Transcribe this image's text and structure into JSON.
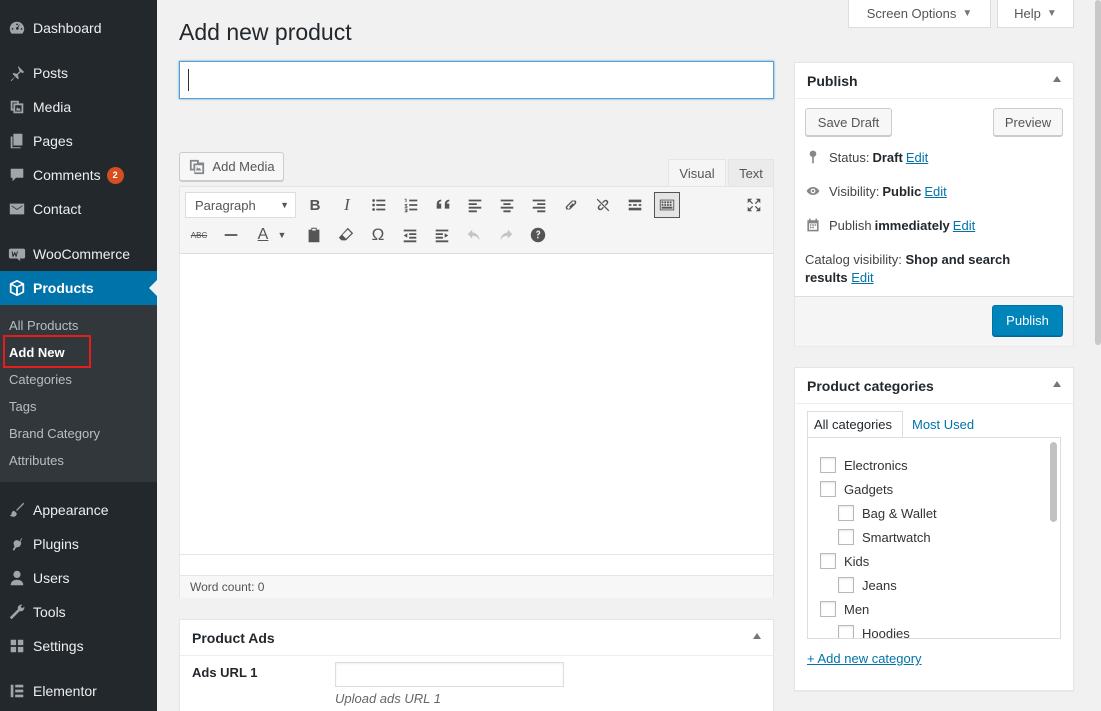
{
  "sidebar": {
    "items": [
      {
        "label": "Dashboard",
        "icon": "dashboard-icon"
      },
      {
        "label": "Posts",
        "icon": "pin-icon"
      },
      {
        "label": "Media",
        "icon": "media-icon"
      },
      {
        "label": "Pages",
        "icon": "pages-icon"
      },
      {
        "label": "Comments",
        "icon": "comment-icon",
        "badge": "2"
      },
      {
        "label": "Contact",
        "icon": "mail-icon"
      },
      {
        "label": "WooCommerce",
        "icon": "woo-icon"
      },
      {
        "label": "Products",
        "icon": "box-icon"
      },
      {
        "label": "Appearance",
        "icon": "brush-icon"
      },
      {
        "label": "Plugins",
        "icon": "plug-icon"
      },
      {
        "label": "Users",
        "icon": "user-icon"
      },
      {
        "label": "Tools",
        "icon": "wrench-icon"
      },
      {
        "label": "Settings",
        "icon": "settings-icon"
      },
      {
        "label": "Elementor",
        "icon": "elementor-icon"
      }
    ],
    "submenu": [
      "All Products",
      "Add New",
      "Categories",
      "Tags",
      "Brand Category",
      "Attributes"
    ]
  },
  "header": {
    "screen_options": "Screen Options",
    "help": "Help"
  },
  "main": {
    "title": "Add new product",
    "title_input_value": "",
    "add_media": "Add Media",
    "tab_visual": "Visual",
    "tab_text": "Text",
    "format_select": "Paragraph",
    "word_count": "Word count: 0"
  },
  "publish": {
    "heading": "Publish",
    "save_draft": "Save Draft",
    "preview": "Preview",
    "status_label": "Status:",
    "status_value": "Draft",
    "visibility_label": "Visibility:",
    "visibility_value": "Public",
    "publish_label": "Publish",
    "publish_value": "immediately",
    "catalog_label": "Catalog visibility:",
    "catalog_value": "Shop and search",
    "catalog_value2": "results",
    "edit": "Edit",
    "publish_button": "Publish"
  },
  "categories": {
    "heading": "Product categories",
    "tab_all": "All categories",
    "tab_used": "Most Used",
    "items": [
      {
        "label": "Electronics",
        "level": 0
      },
      {
        "label": "Gadgets",
        "level": 0
      },
      {
        "label": "Bag & Wallet",
        "level": 1
      },
      {
        "label": "Smartwatch",
        "level": 1
      },
      {
        "label": "Kids",
        "level": 0
      },
      {
        "label": "Jeans",
        "level": 1
      },
      {
        "label": "Men",
        "level": 0
      },
      {
        "label": "Hoodies",
        "level": 1
      }
    ],
    "add_new": "+ Add new category"
  },
  "ads": {
    "heading": "Product Ads",
    "label": "Ads URL 1",
    "description": "Upload ads URL 1"
  },
  "colors": {
    "sidebar": "#23282d",
    "accent": "#0073aa",
    "publish_button": "#0085ba",
    "badge": "#d54e21"
  }
}
